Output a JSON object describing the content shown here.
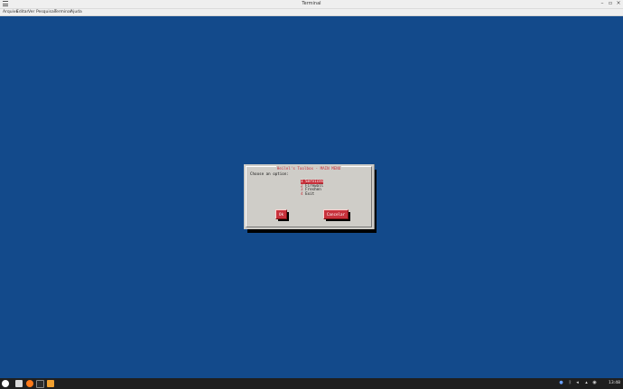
{
  "window": {
    "title": "Terminal",
    "controls": [
      "minimize-icon",
      "maximize-icon",
      "close-icon"
    ]
  },
  "menubar": {
    "items": [
      "Arquivo",
      "Editar",
      "Ver",
      "Pesquisar",
      "Terminal",
      "Ajuda"
    ]
  },
  "dialog": {
    "title": "Heilel's Toolbox - MAIN MENU",
    "prompt": "Choose an option:",
    "options": [
      {
        "num": "1",
        "label": "Services",
        "selected": true
      },
      {
        "num": "2",
        "label": "Firewall",
        "selected": false
      },
      {
        "num": "3",
        "label": "Freshen",
        "selected": false
      },
      {
        "num": "4",
        "label": "Exit",
        "selected": false
      }
    ],
    "ok_label": "Ok",
    "cancel_label": "Cancelar"
  },
  "colors": {
    "terminal_bg": "#134a8b",
    "dialog_bg": "#cfcdc8",
    "accent": "#c8323c"
  },
  "taskbar": {
    "apps": [
      "start-menu-icon",
      "files-icon",
      "firefox-icon",
      "terminal-icon",
      "sublime-icon"
    ],
    "tray": [
      "update-icon",
      "bluetooth-icon",
      "volume-icon",
      "wifi-icon",
      "notification-icon"
    ],
    "clock": "13:48"
  }
}
